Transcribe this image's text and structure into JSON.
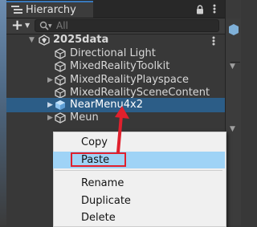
{
  "hierarchy": {
    "tab_title": "Hierarchy",
    "search_placeholder": "All",
    "rows": [
      {
        "label": "2025data"
      },
      {
        "label": "Directional Light"
      },
      {
        "label": "MixedRealityToolkit"
      },
      {
        "label": "MixedRealityPlayspace"
      },
      {
        "label": "MixedRealitySceneContent"
      },
      {
        "label": "NearMenu4x2"
      },
      {
        "label": "Meun"
      }
    ]
  },
  "context_menu": {
    "items": [
      {
        "label": "Copy"
      },
      {
        "label": "Paste"
      },
      {
        "label": "Rename"
      },
      {
        "label": "Duplicate"
      },
      {
        "label": "Delete"
      }
    ]
  },
  "colors": {
    "selection": "#2c5d87",
    "menu_highlight": "#9fd3f6",
    "annotation": "#e0202d"
  },
  "icons": [
    "hierarchy-icon",
    "lock-icon",
    "more-icon",
    "add-icon",
    "search-icon",
    "unity-scene-icon",
    "gameobject-icon",
    "prefab-icon",
    "fold-arrow-icon"
  ]
}
